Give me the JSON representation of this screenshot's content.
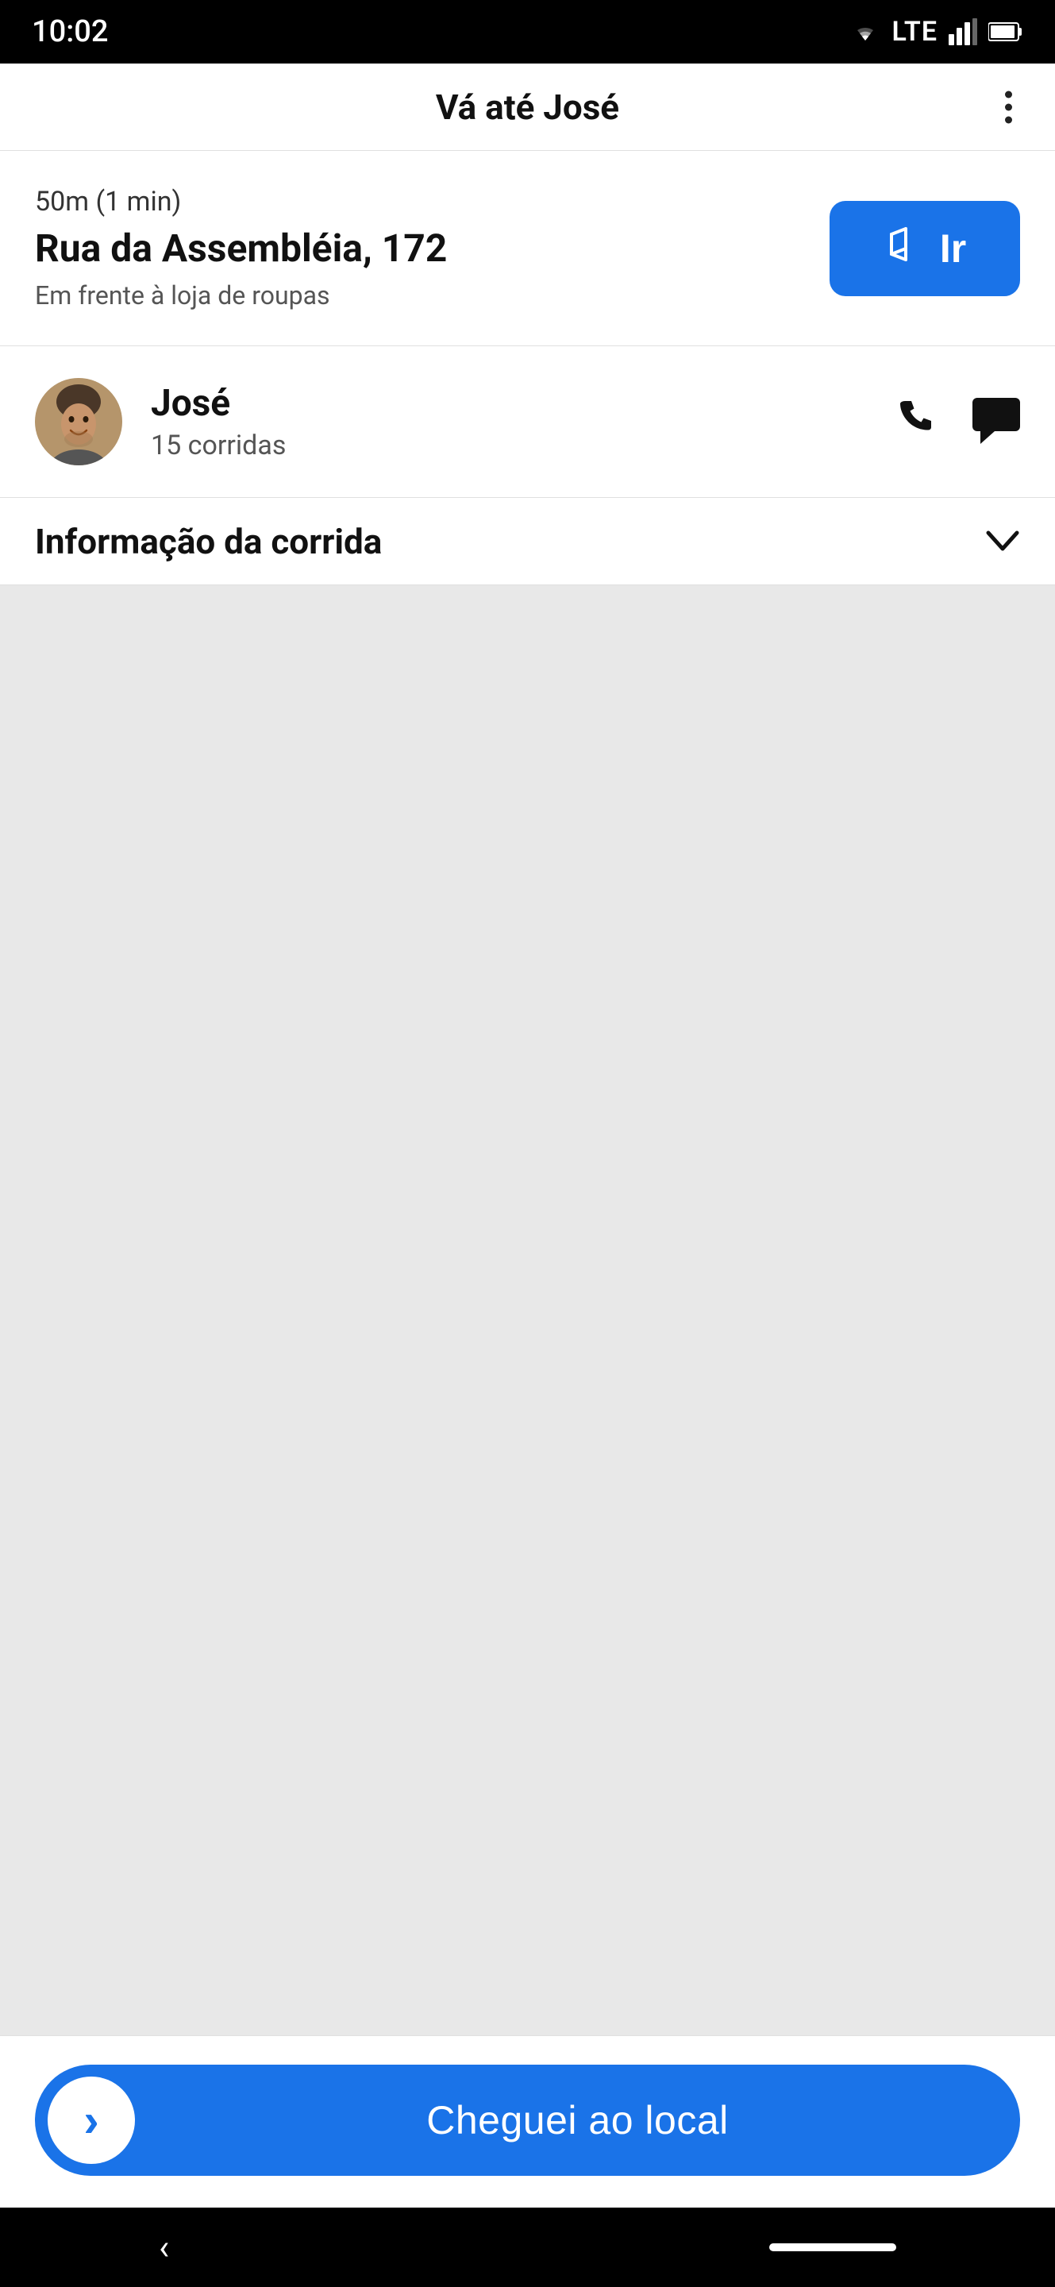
{
  "statusBar": {
    "time": "10:02",
    "wifi": "▼",
    "lte": "LTE",
    "signal": "▲",
    "battery": "🔋"
  },
  "header": {
    "title": "Vá até José",
    "menuIcon": "more-vertical"
  },
  "address": {
    "distance": "50m (1 min)",
    "street": "Rua da Assembléia, 172",
    "note": "Em frente à loja de roupas",
    "goButton": "Ir"
  },
  "rider": {
    "name": "José",
    "rides": "15 corridas",
    "phoneAction": "phone",
    "chatAction": "chat"
  },
  "rideInfo": {
    "label": "Informação da corrida",
    "expandIcon": "chevron-down"
  },
  "arrivedButton": {
    "label": "Cheguei ao local"
  }
}
